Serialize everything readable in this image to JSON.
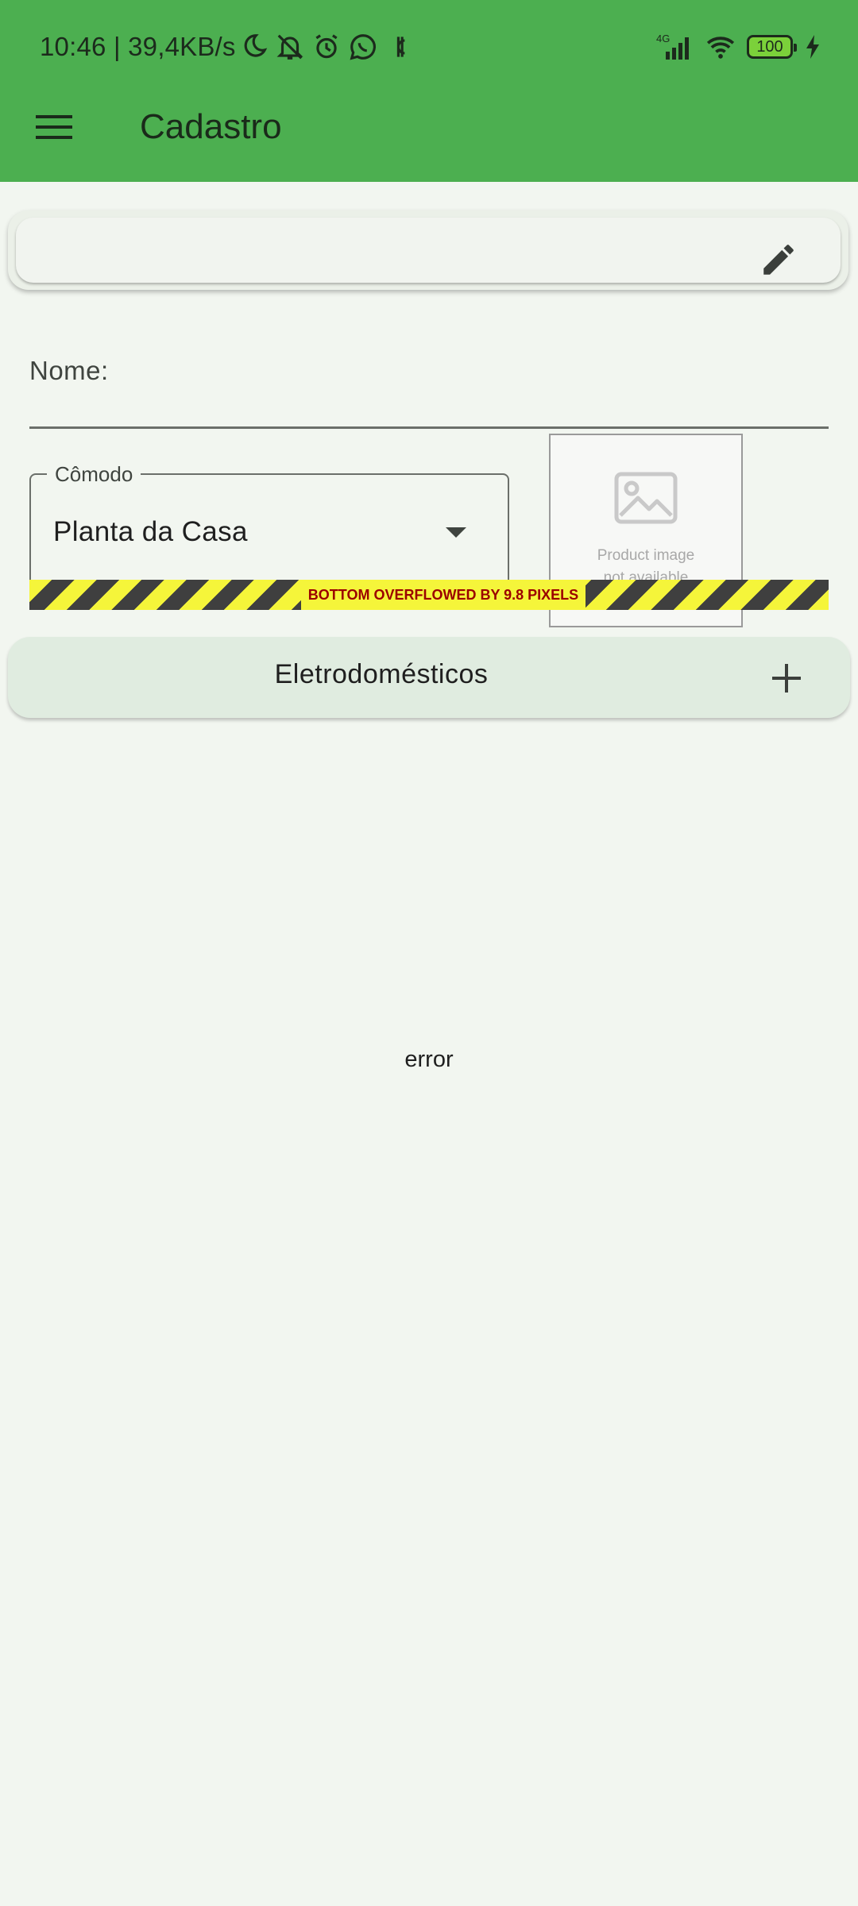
{
  "status_bar": {
    "time": "10:46 | 39,4KB/s",
    "network": "4G",
    "battery": "100",
    "icons_left": [
      "moon-icon",
      "bell-off-icon",
      "alarm-icon",
      "whatsapp-icon",
      "currency-icon"
    ],
    "icons_right": [
      "signal-icon",
      "wifi-icon",
      "battery-icon",
      "charging-icon"
    ]
  },
  "app_bar": {
    "title": "Cadastro",
    "menu_icon": "hamburger-menu-icon",
    "color": "#4caf50"
  },
  "top_card": {
    "edit_icon": "pencil-icon"
  },
  "form": {
    "nome_label": "Nome:",
    "comodo_label": "Cômodo",
    "comodo_value": "Planta da Casa",
    "product_image_line1": "Product image",
    "product_image_line2": "not available"
  },
  "overflow_warning": "BOTTOM OVERFLOWED BY 9.8 PIXELS",
  "eletrodomesticos": {
    "label": "Eletrodomésticos",
    "add_icon": "plus-icon"
  },
  "error_text": "error",
  "colors": {
    "background": "#f2f6f0",
    "overflow_yellow": "#f5f53a",
    "overflow_text": "#9b0000"
  }
}
